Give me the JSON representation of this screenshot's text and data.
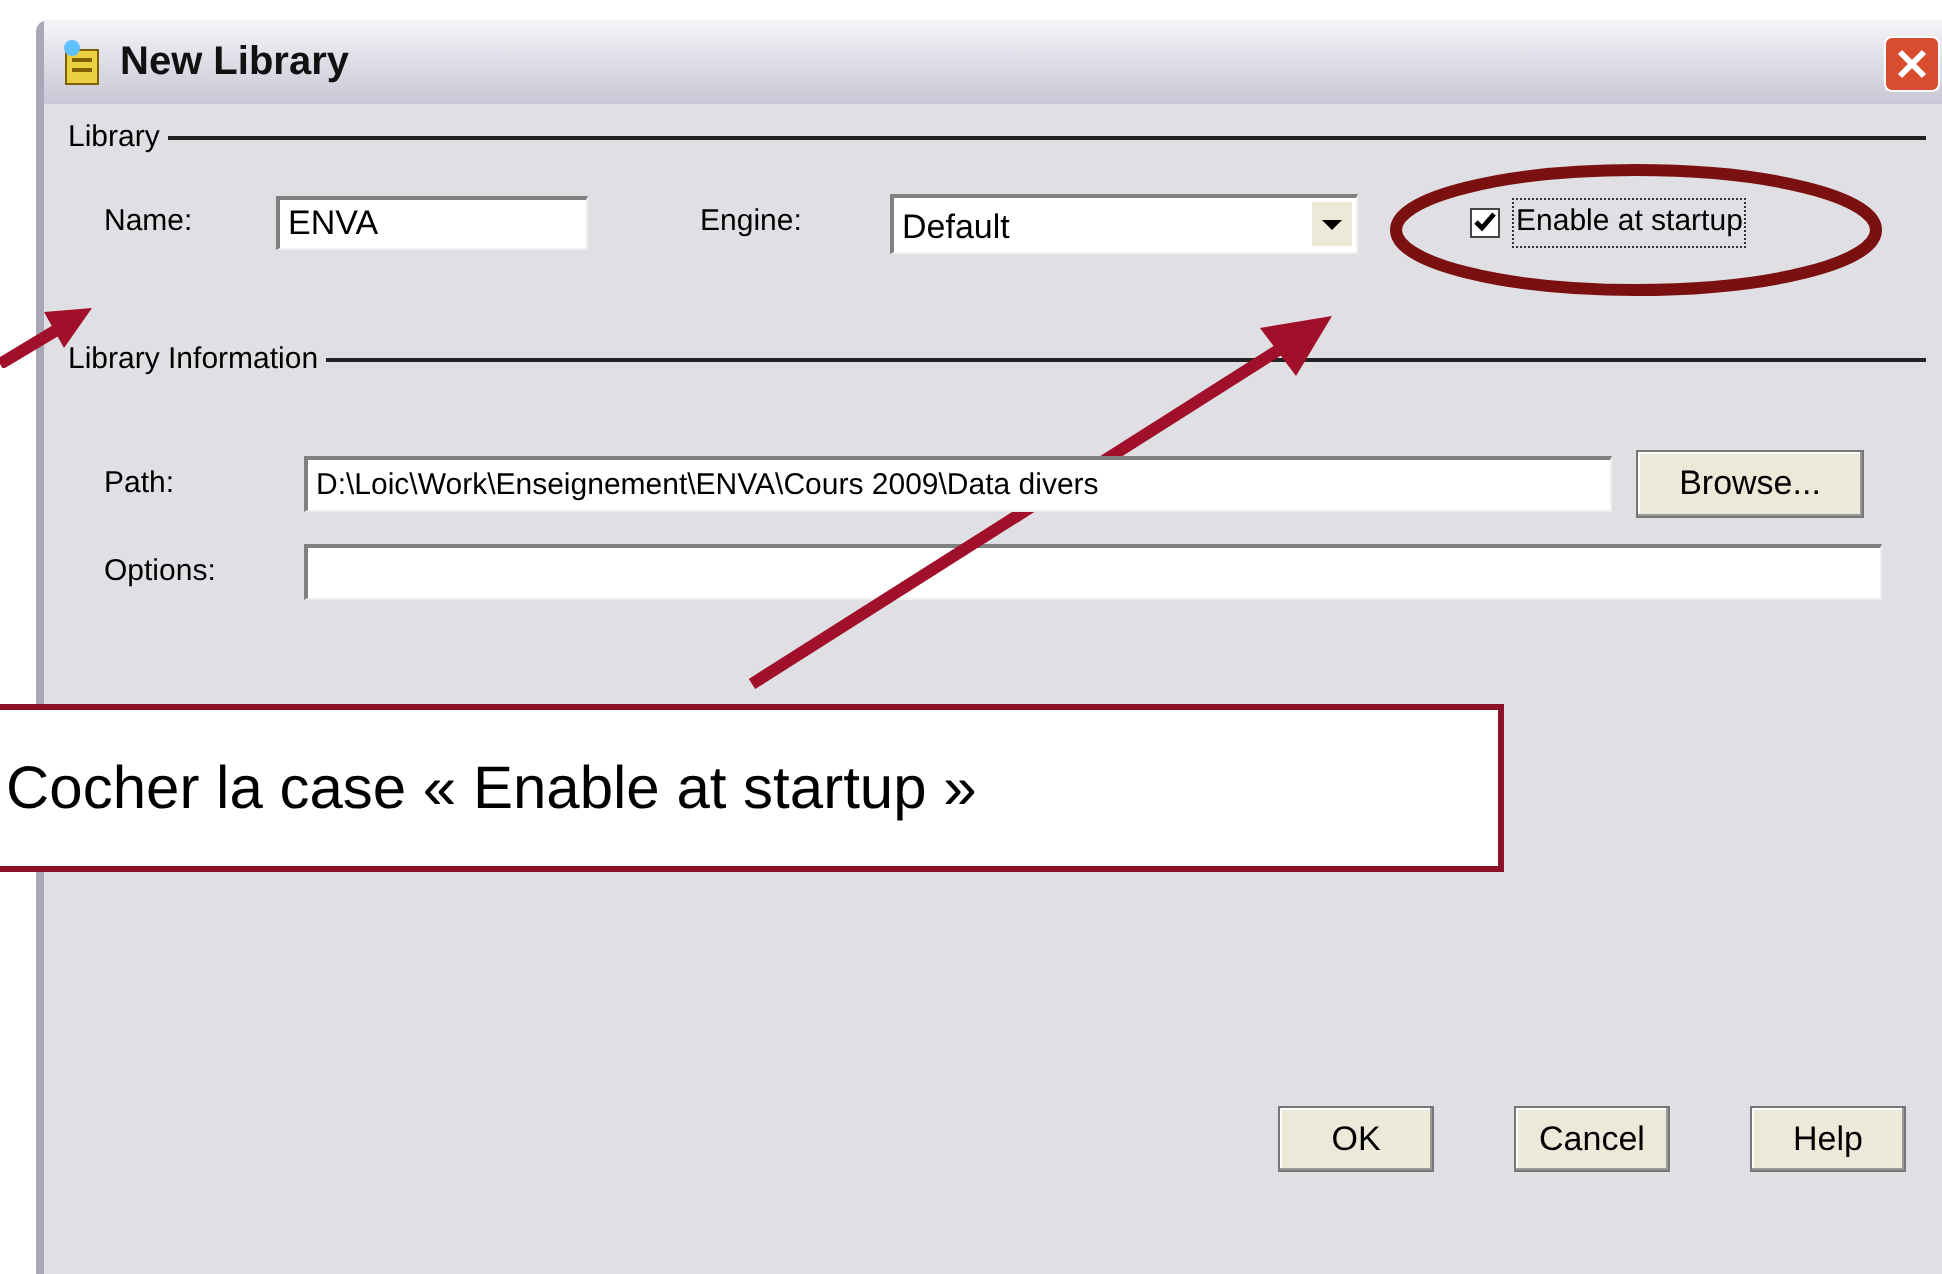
{
  "window": {
    "title": "New Library"
  },
  "library": {
    "legend": "Library",
    "name": {
      "label": "Name:",
      "value": "ENVA"
    },
    "engine": {
      "label": "Engine:",
      "value": "Default"
    },
    "enable": {
      "label": "Enable at startup",
      "checked": true
    }
  },
  "library_information": {
    "legend": "Library Information",
    "path": {
      "label": "Path:",
      "value": "D:\\Loic\\Work\\Enseignement\\ENVA\\Cours 2009\\Data divers"
    },
    "browse": {
      "label": "Browse..."
    },
    "options": {
      "label": "Options:"
    }
  },
  "buttons": [
    {
      "label": "OK"
    },
    {
      "label": "Cancel"
    },
    {
      "label": "Help"
    }
  ],
  "callout": {
    "text": "Cocher la case « Enable at startup »"
  }
}
